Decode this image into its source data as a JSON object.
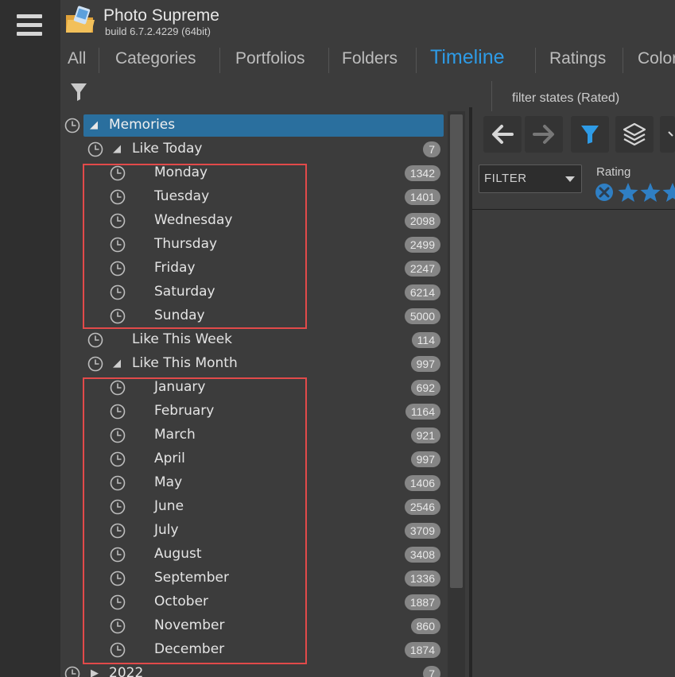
{
  "app": {
    "title": "Photo Supreme",
    "build": "build 6.7.2.4229 (64bit)"
  },
  "tabs": [
    {
      "label": "All",
      "active": false
    },
    {
      "label": "Categories",
      "active": false
    },
    {
      "label": "Portfolios",
      "active": false
    },
    {
      "label": "Folders",
      "active": false
    },
    {
      "label": "Timeline",
      "active": true
    },
    {
      "label": "Ratings",
      "active": false
    },
    {
      "label": "Color",
      "active": false
    }
  ],
  "tree": {
    "memories": {
      "label": "Memories"
    },
    "like_today": {
      "label": "Like Today",
      "count": "7"
    },
    "days": [
      {
        "label": "Monday",
        "count": "1342"
      },
      {
        "label": "Tuesday",
        "count": "1401"
      },
      {
        "label": "Wednesday",
        "count": "2098"
      },
      {
        "label": "Thursday",
        "count": "2499"
      },
      {
        "label": "Friday",
        "count": "2247"
      },
      {
        "label": "Saturday",
        "count": "6214"
      },
      {
        "label": "Sunday",
        "count": "5000"
      }
    ],
    "like_this_week": {
      "label": "Like This Week",
      "count": "114"
    },
    "like_this_month": {
      "label": "Like This Month",
      "count": "997"
    },
    "months": [
      {
        "label": "January",
        "count": "692"
      },
      {
        "label": "February",
        "count": "1164"
      },
      {
        "label": "March",
        "count": "921"
      },
      {
        "label": "April",
        "count": "997"
      },
      {
        "label": "May",
        "count": "1406"
      },
      {
        "label": "June",
        "count": "2546"
      },
      {
        "label": "July",
        "count": "3709"
      },
      {
        "label": "August",
        "count": "3408"
      },
      {
        "label": "September",
        "count": "1336"
      },
      {
        "label": "October",
        "count": "1887"
      },
      {
        "label": "November",
        "count": "860"
      },
      {
        "label": "December",
        "count": "1874"
      }
    ],
    "year_2022": {
      "label": "2022",
      "count": "7"
    }
  },
  "right_panel": {
    "filter_tab": "filter states (Rated)",
    "filter_select": "FILTER",
    "rating_label": "Rating"
  },
  "colors": {
    "accent": "#2e9be6",
    "selection": "#2a6f9e",
    "highlight_box": "#e24a4a",
    "badge": "#858585",
    "star": "#2f7fc4"
  },
  "icons": [
    "menu-icon",
    "app-logo-icon",
    "filter-funnel-icon",
    "clock-icon",
    "expand-triangle-icon",
    "collapse-triangle-icon",
    "back-arrow-icon",
    "forward-arrow-icon",
    "layers-icon",
    "clear-rating-icon",
    "star-icon"
  ]
}
